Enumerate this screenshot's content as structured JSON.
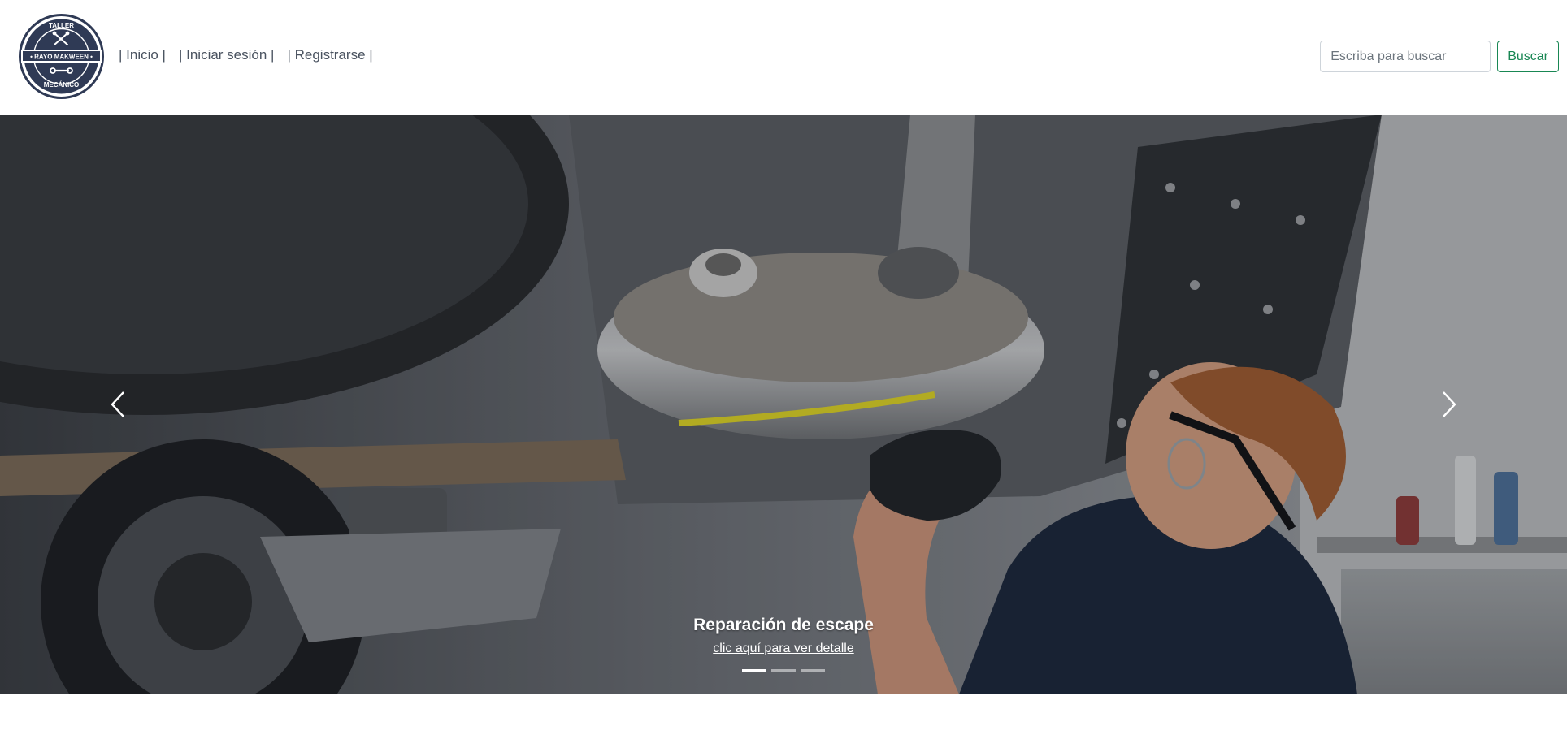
{
  "logo": {
    "top_text": "TALLER",
    "band_text": "RAYO MAKWEEN",
    "bottom_text": "MECÁNICO",
    "color": "#2f3a55"
  },
  "nav": {
    "links": [
      {
        "label": "| Inicio |"
      },
      {
        "label": "| Iniciar sesión |"
      },
      {
        "label": "| Registrarse |"
      }
    ]
  },
  "search": {
    "placeholder": "Escriba para buscar",
    "value": "",
    "button_label": "Buscar",
    "accent": "#198754"
  },
  "carousel": {
    "caption_title": "Reparación de escape",
    "caption_link": "clic aquí para ver detalle",
    "slides_count": 3,
    "active_index": 0,
    "prev_icon": "chevron-left-icon",
    "next_icon": "chevron-right-icon"
  }
}
